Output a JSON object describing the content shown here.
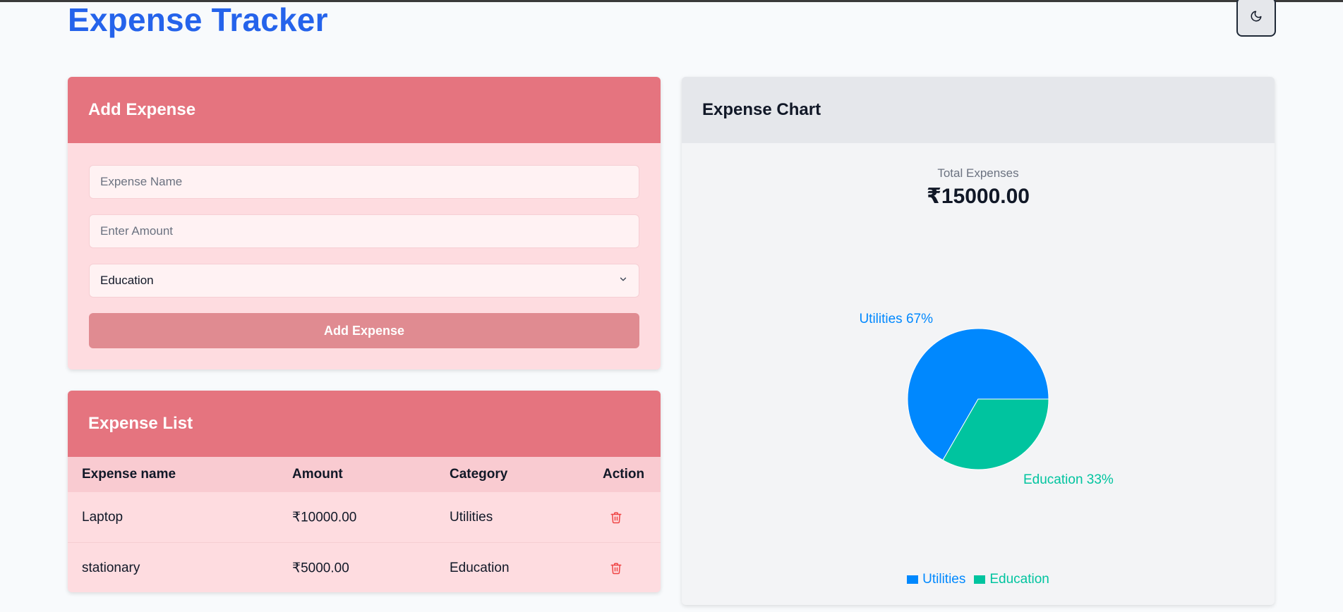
{
  "header": {
    "title": "Expense Tracker",
    "theme_toggle_icon": "moon-icon"
  },
  "add_form": {
    "title": "Add Expense",
    "name_placeholder": "Expense Name",
    "amount_placeholder": "Enter Amount",
    "category_selected": "Education",
    "submit_label": "Add Expense"
  },
  "expense_list": {
    "title": "Expense List",
    "columns": [
      "Expense name",
      "Amount",
      "Category",
      "Action"
    ],
    "rows": [
      {
        "name": "Laptop",
        "amount": "₹10000.00",
        "category": "Utilities",
        "action_icon": "trash-icon"
      },
      {
        "name": "stationary",
        "amount": "₹5000.00",
        "category": "Education",
        "action_icon": "trash-icon"
      }
    ]
  },
  "chart_panel": {
    "title": "Expense Chart",
    "total_label": "Total Expenses",
    "total_value": "₹15000.00"
  },
  "chart_data": {
    "type": "pie",
    "slices": [
      {
        "label": "Utilities",
        "value": 10000,
        "percent_label": "Utilities 67%",
        "color": "#0088fe"
      },
      {
        "label": "Education",
        "value": 5000,
        "percent_label": "Education 33%",
        "color": "#00c49f"
      }
    ],
    "legend": [
      "Utilities",
      "Education"
    ],
    "legend_position": "bottom"
  },
  "colors": {
    "accent": "#2563eb",
    "card_header": "#e5747f",
    "card_body": "#fedce0",
    "button": "#e08b91",
    "delete": "#ef4444"
  }
}
